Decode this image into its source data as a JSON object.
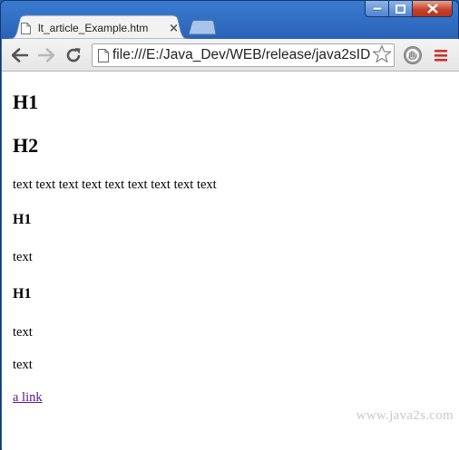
{
  "tab": {
    "title": "lt_article_Example.htm",
    "close_glyph": "×"
  },
  "toolbar": {
    "address": "file:///E:/Java_Dev/WEB/release/java2sID"
  },
  "page": {
    "heading_1": "H1",
    "heading_2": "H2",
    "paragraph": "text text text text text text text text text",
    "heading_3": "H1",
    "text_1": "text",
    "heading_4": "H1",
    "text_2": "text",
    "text_3": "text",
    "link": "a link",
    "watermark": "www.java2s.com"
  },
  "icons": {
    "back": "back-arrow-icon",
    "forward": "forward-arrow-icon",
    "reload": "reload-icon",
    "bookmark": "star-icon",
    "extension": "extension-icon",
    "menu": "menu-icon"
  },
  "colors": {
    "frame": "#2a64b8",
    "link": "#551a8b",
    "menu": "#d0312d"
  }
}
